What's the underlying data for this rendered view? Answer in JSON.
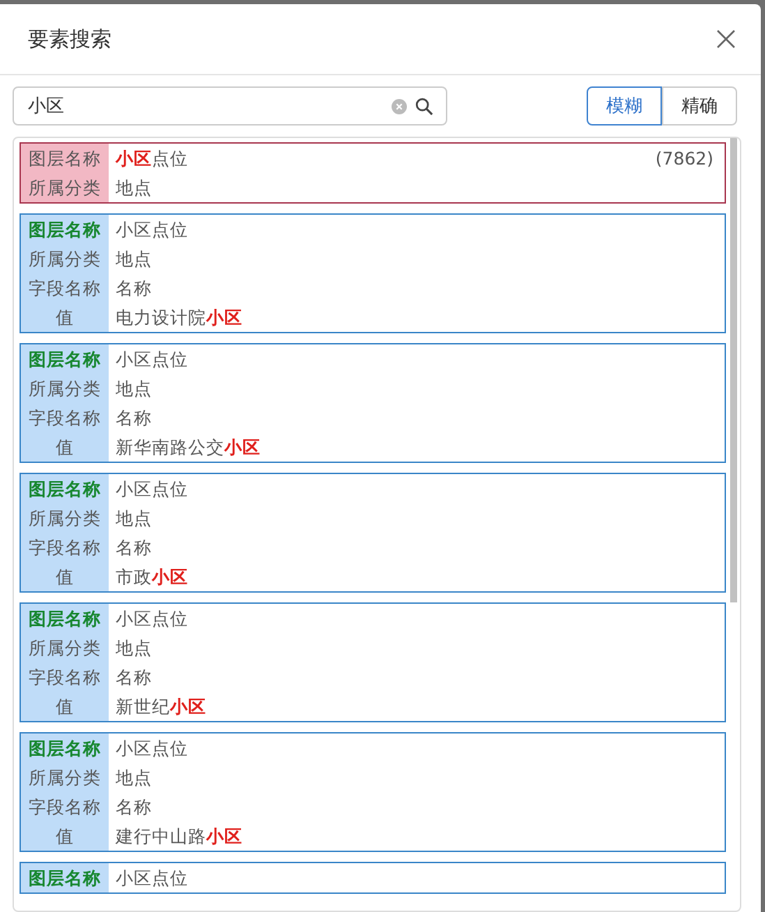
{
  "window": {
    "title": "要素搜索"
  },
  "search": {
    "value": "小区"
  },
  "modes": [
    {
      "label": "模糊",
      "selected": true
    },
    {
      "label": "精确",
      "selected": false
    }
  ],
  "results": [
    {
      "kind": "layer",
      "count": "(7862)",
      "rows": [
        {
          "label": "图层名称",
          "value": "**小区**点位"
        },
        {
          "label": "所属分类",
          "value": "地点"
        }
      ]
    },
    {
      "kind": "record",
      "rows": [
        {
          "label": "图层名称",
          "value": "小区点位"
        },
        {
          "label": "所属分类",
          "value": "地点"
        },
        {
          "label": "字段名称",
          "value": "名称"
        },
        {
          "label": "值",
          "value": "电力设计院**小区**"
        }
      ]
    },
    {
      "kind": "record",
      "rows": [
        {
          "label": "图层名称",
          "value": "小区点位"
        },
        {
          "label": "所属分类",
          "value": "地点"
        },
        {
          "label": "字段名称",
          "value": "名称"
        },
        {
          "label": "值",
          "value": "新华南路公交**小区**"
        }
      ]
    },
    {
      "kind": "record",
      "rows": [
        {
          "label": "图层名称",
          "value": "小区点位"
        },
        {
          "label": "所属分类",
          "value": "地点"
        },
        {
          "label": "字段名称",
          "value": "名称"
        },
        {
          "label": "值",
          "value": "市政**小区**"
        }
      ]
    },
    {
      "kind": "record",
      "rows": [
        {
          "label": "图层名称",
          "value": "小区点位"
        },
        {
          "label": "所属分类",
          "value": "地点"
        },
        {
          "label": "字段名称",
          "value": "名称"
        },
        {
          "label": "值",
          "value": "新世纪**小区**"
        }
      ]
    },
    {
      "kind": "record",
      "rows": [
        {
          "label": "图层名称",
          "value": "小区点位"
        },
        {
          "label": "所属分类",
          "value": "地点"
        },
        {
          "label": "字段名称",
          "value": "名称"
        },
        {
          "label": "值",
          "value": "建行中山路**小区**"
        }
      ]
    },
    {
      "kind": "record",
      "rows": [
        {
          "label": "图层名称",
          "value": "小区点位"
        }
      ]
    }
  ]
}
